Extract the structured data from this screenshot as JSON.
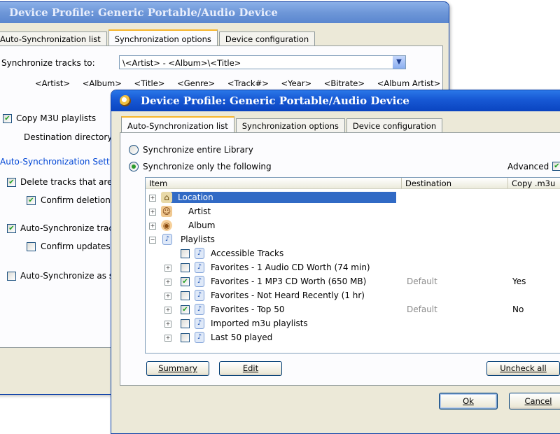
{
  "back_window": {
    "title": "Device Profile: Generic Portable/Audio Device",
    "tabs": [
      "Auto-Synchronization list",
      "Synchronization options",
      "Device configuration"
    ],
    "sync_tracks_label": "Synchronize tracks to:",
    "sync_tracks_value": "\\<Artist> - <Album>\\<Title>",
    "tokens": [
      "<Artist>",
      "<Album>",
      "<Title>",
      "<Genre>",
      "<Track#>",
      "<Year>",
      "<Bitrate>",
      "<Album Artist>",
      "»"
    ],
    "copy_m3u_label": "Copy M3U playlists",
    "dest_dir_label": "Destination directory:",
    "auto_sync_group": "Auto-Synchronization Sett",
    "delete_tracks_label": "Delete tracks that are",
    "confirm_deletion_label": "Confirm deletion (",
    "auto_sync_tracks_label": "Auto-Synchronize track",
    "confirm_updates_label": "Confirm updates (",
    "auto_sync_as_label": "Auto-Synchronize as s"
  },
  "front_window": {
    "title": "Device Profile: Generic Portable/Audio Device",
    "tabs": [
      "Auto-Synchronization list",
      "Synchronization options",
      "Device configuration"
    ],
    "radio_entire": "Synchronize entire Library",
    "radio_only": "Synchronize only the following",
    "advanced_label": "Advanced",
    "columns": [
      "Item",
      "Destination",
      "Copy .m3u"
    ],
    "rows": [
      {
        "label": "Location",
        "destination": "",
        "copy": ""
      },
      {
        "label": "Artist",
        "destination": "",
        "copy": ""
      },
      {
        "label": "Album",
        "destination": "",
        "copy": ""
      },
      {
        "label": "Playlists",
        "destination": "",
        "copy": ""
      },
      {
        "label": "Accessible Tracks",
        "destination": "",
        "copy": ""
      },
      {
        "label": "Favorites - 1 Audio CD Worth (74 min)",
        "destination": "",
        "copy": ""
      },
      {
        "label": "Favorites - 1 MP3 CD Worth (650 MB)",
        "destination": "Default",
        "copy": "Yes"
      },
      {
        "label": "Favorites - Not Heard Recently (1 hr)",
        "destination": "",
        "copy": ""
      },
      {
        "label": "Favorites - Top 50",
        "destination": "Default",
        "copy": "No"
      },
      {
        "label": "Imported m3u playlists",
        "destination": "",
        "copy": ""
      },
      {
        "label": "Last 50 played",
        "destination": "",
        "copy": ""
      }
    ],
    "buttons": {
      "summary": "Summary",
      "edit": "Edit",
      "uncheck_all": "Uncheck all",
      "ok": "Ok",
      "cancel": "Cancel"
    }
  },
  "colors": {
    "titlebar": "#0a44c0",
    "selection": "#316ac5",
    "window_bg": "#ece9d8"
  }
}
